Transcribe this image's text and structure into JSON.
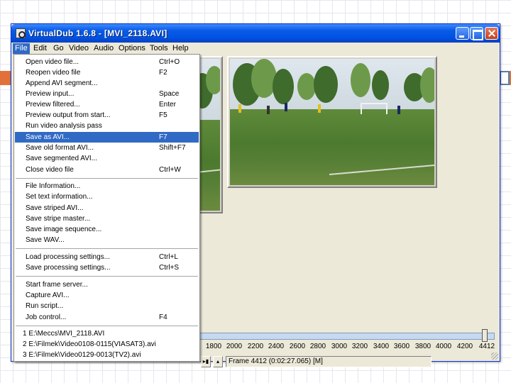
{
  "window": {
    "title": "VirtualDub 1.6.8 - [MVI_2118.AVI]"
  },
  "menubar": {
    "items": [
      {
        "label": "File"
      },
      {
        "label": "Edit"
      },
      {
        "label": "Go"
      },
      {
        "label": "Video"
      },
      {
        "label": "Audio"
      },
      {
        "label": "Options"
      },
      {
        "label": "Tools"
      },
      {
        "label": "Help"
      }
    ]
  },
  "file_menu": {
    "items": [
      {
        "label": "Open video file...",
        "shortcut": "Ctrl+O"
      },
      {
        "label": "Reopen video file",
        "shortcut": "F2"
      },
      {
        "label": "Append AVI segment...",
        "shortcut": ""
      },
      {
        "label": "Preview input...",
        "shortcut": "Space"
      },
      {
        "label": "Preview filtered...",
        "shortcut": "Enter"
      },
      {
        "label": "Preview output from start...",
        "shortcut": "F5"
      },
      {
        "label": "Run video analysis pass",
        "shortcut": ""
      },
      {
        "label": "Save as AVI...",
        "shortcut": "F7"
      },
      {
        "label": "Save old format AVI...",
        "shortcut": "Shift+F7"
      },
      {
        "label": "Save segmented AVI...",
        "shortcut": ""
      },
      {
        "label": "Close video file",
        "shortcut": "Ctrl+W"
      },
      {
        "label": "File Information...",
        "shortcut": ""
      },
      {
        "label": "Set text information...",
        "shortcut": ""
      },
      {
        "label": "Save striped AVI...",
        "shortcut": ""
      },
      {
        "label": "Save stripe master...",
        "shortcut": ""
      },
      {
        "label": "Save image sequence...",
        "shortcut": ""
      },
      {
        "label": "Save WAV...",
        "shortcut": ""
      },
      {
        "label": "Load processing settings...",
        "shortcut": "Ctrl+L"
      },
      {
        "label": "Save processing settings...",
        "shortcut": "Ctrl+S"
      },
      {
        "label": "Start frame server...",
        "shortcut": ""
      },
      {
        "label": "Capture AVI...",
        "shortcut": ""
      },
      {
        "label": "Run script...",
        "shortcut": ""
      },
      {
        "label": "Job control...",
        "shortcut": "F4"
      },
      {
        "label": "1 E:\\Meccs\\MVI_2118.AVI",
        "shortcut": ""
      },
      {
        "label": "2 E:\\Filmek\\Video0108-0115(VIASAT3).avi",
        "shortcut": ""
      },
      {
        "label": "3 E:\\Filmek\\Video0129-0013(TV2).avi",
        "shortcut": ""
      }
    ]
  },
  "timeline": {
    "ticks": [
      "1800",
      "2000",
      "2200",
      "2400",
      "2600",
      "2800",
      "3000",
      "3200",
      "3400",
      "3600",
      "3800",
      "4000",
      "4200",
      "4412"
    ],
    "position_frame": 4412
  },
  "status": {
    "frame_text": "Frame 4412 (0:02:27.065) [M]"
  },
  "colors": {
    "titlebar": "#0054e3",
    "menu_highlight": "#316ac5",
    "accent_bar": "#e2703a"
  }
}
